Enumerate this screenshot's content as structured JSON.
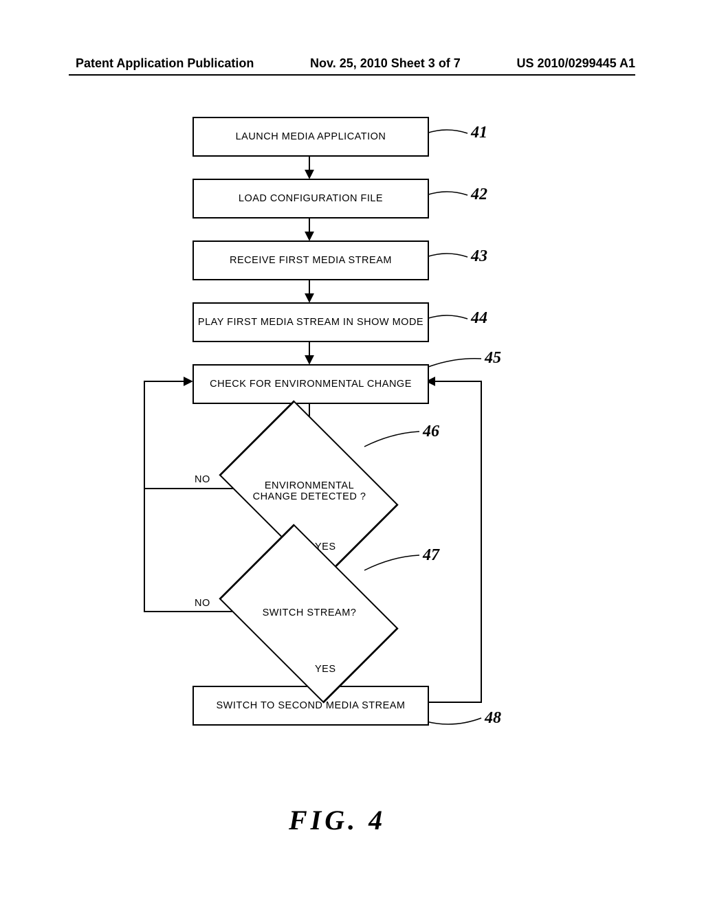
{
  "header": {
    "left": "Patent Application Publication",
    "center": "Nov. 25, 2010  Sheet 3 of 7",
    "right": "US 2010/0299445 A1"
  },
  "boxes": {
    "b41": "LAUNCH MEDIA APPLICATION",
    "b42": "LOAD CONFIGURATION FILE",
    "b43": "RECEIVE FIRST MEDIA STREAM",
    "b44": "PLAY FIRST MEDIA STREAM IN SHOW MODE",
    "b45": "CHECK FOR ENVIRONMENTAL CHANGE",
    "b46": "ENVIRONMENTAL CHANGE DETECTED ?",
    "b47": "SWITCH STREAM?",
    "b48": "SWITCH TO SECOND MEDIA STREAM"
  },
  "refs": {
    "r41": "41",
    "r42": "42",
    "r43": "43",
    "r44": "44",
    "r45": "45",
    "r46": "46",
    "r47": "47",
    "r48": "48"
  },
  "labels": {
    "yes": "YES",
    "no": "NO"
  },
  "figure": "FIG.  4"
}
